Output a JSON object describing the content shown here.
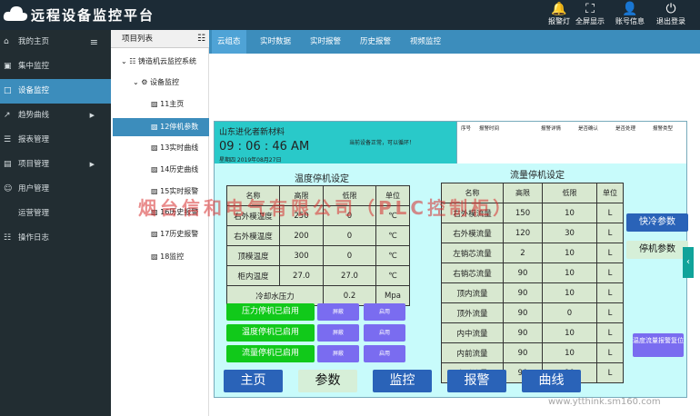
{
  "app": {
    "title": "远程设备监控平台"
  },
  "toolbar": [
    {
      "label": "报警灯",
      "icon": "bell-icon"
    },
    {
      "label": "全屏显示",
      "icon": "fullscreen-icon"
    },
    {
      "label": "账号信息",
      "icon": "user-icon"
    },
    {
      "label": "退出登录",
      "icon": "logout-icon"
    }
  ],
  "sidebar": [
    {
      "label": "我的主页"
    },
    {
      "label": "集中监控"
    },
    {
      "label": "设备监控"
    },
    {
      "label": "趋势曲线"
    },
    {
      "label": "报表管理"
    },
    {
      "label": "项目管理"
    },
    {
      "label": "用户管理"
    },
    {
      "label": "运营管理"
    },
    {
      "label": "操作日志"
    }
  ],
  "tree": {
    "header": "项目列表",
    "root": "铸造机云监控系统",
    "group": "设备监控",
    "items": [
      "11主页",
      "12停机参数",
      "13实时曲线",
      "14历史曲线",
      "15实时报警",
      "16历史报警",
      "17历史报警",
      "18监控"
    ]
  },
  "tabs": [
    "云组态",
    "实时数据",
    "实时报警",
    "历史报警",
    "视频监控"
  ],
  "panel": {
    "company": "山东进化者新材料",
    "time": "09 : 06 : 46 AM",
    "date": "星期四 2019年08月27日",
    "warning": "当前设备正常，可以循环！",
    "alarm_cols": [
      "序号",
      "报警时间",
      "报警详情",
      "是否确认",
      "是否处理",
      "报警类型"
    ],
    "temp": {
      "title": "温度停机设定",
      "headers": [
        "名称",
        "高限",
        "低限",
        "单位"
      ],
      "rows": [
        [
          "右外模温度",
          "250",
          "0",
          "℃"
        ],
        [
          "右外模温度",
          "200",
          "0",
          "℃"
        ],
        [
          "顶模温度",
          "300",
          "0",
          "℃"
        ],
        [
          "柜内温度",
          "27.0",
          "27.0",
          "℃"
        ]
      ],
      "pressure": {
        "name": "冷却水压力",
        "value": "0.2",
        "unit": "Mpa"
      }
    },
    "flow": {
      "title": "流量停机设定",
      "headers": [
        "名称",
        "高限",
        "低限",
        "单位"
      ],
      "rows": [
        [
          "右外模流量",
          "150",
          "10",
          "L"
        ],
        [
          "右外模流量",
          "120",
          "30",
          "L"
        ],
        [
          "左销芯流量",
          "2",
          "10",
          "L"
        ],
        [
          "右销芯流量",
          "90",
          "10",
          "L"
        ],
        [
          "顶内流量",
          "90",
          "10",
          "L"
        ],
        [
          "顶外流量",
          "90",
          "0",
          "L"
        ],
        [
          "内中流量",
          "90",
          "10",
          "L"
        ],
        [
          "内前流量",
          "90",
          "10",
          "L"
        ],
        [
          "内后流量",
          "90",
          "10",
          "L"
        ]
      ]
    },
    "stop_buttons": [
      "压力停机已启用",
      "温度停机已启用",
      "流量停机已启用"
    ],
    "shield_label": "屏蔽",
    "enable_label": "启用",
    "nav_buttons": [
      "主页",
      "参数",
      "监控",
      "报警",
      "曲线"
    ],
    "side_buttons": [
      "快冷参数",
      "停机参数"
    ],
    "reset_button": "温度流量报警复位"
  },
  "watermark": "烟台信和电气有限公司（PLC控制柜）",
  "url": "www.ytthink.sm160.com",
  "colors": {
    "topbar": "#1c2b36",
    "sidebar": "#222d32",
    "accent": "#3c8dbc",
    "panel": "#c8fbfb",
    "header": "#29c9c9",
    "green": "#11c91a",
    "purple": "#7a6cf0",
    "nav": "#2a63b8"
  }
}
